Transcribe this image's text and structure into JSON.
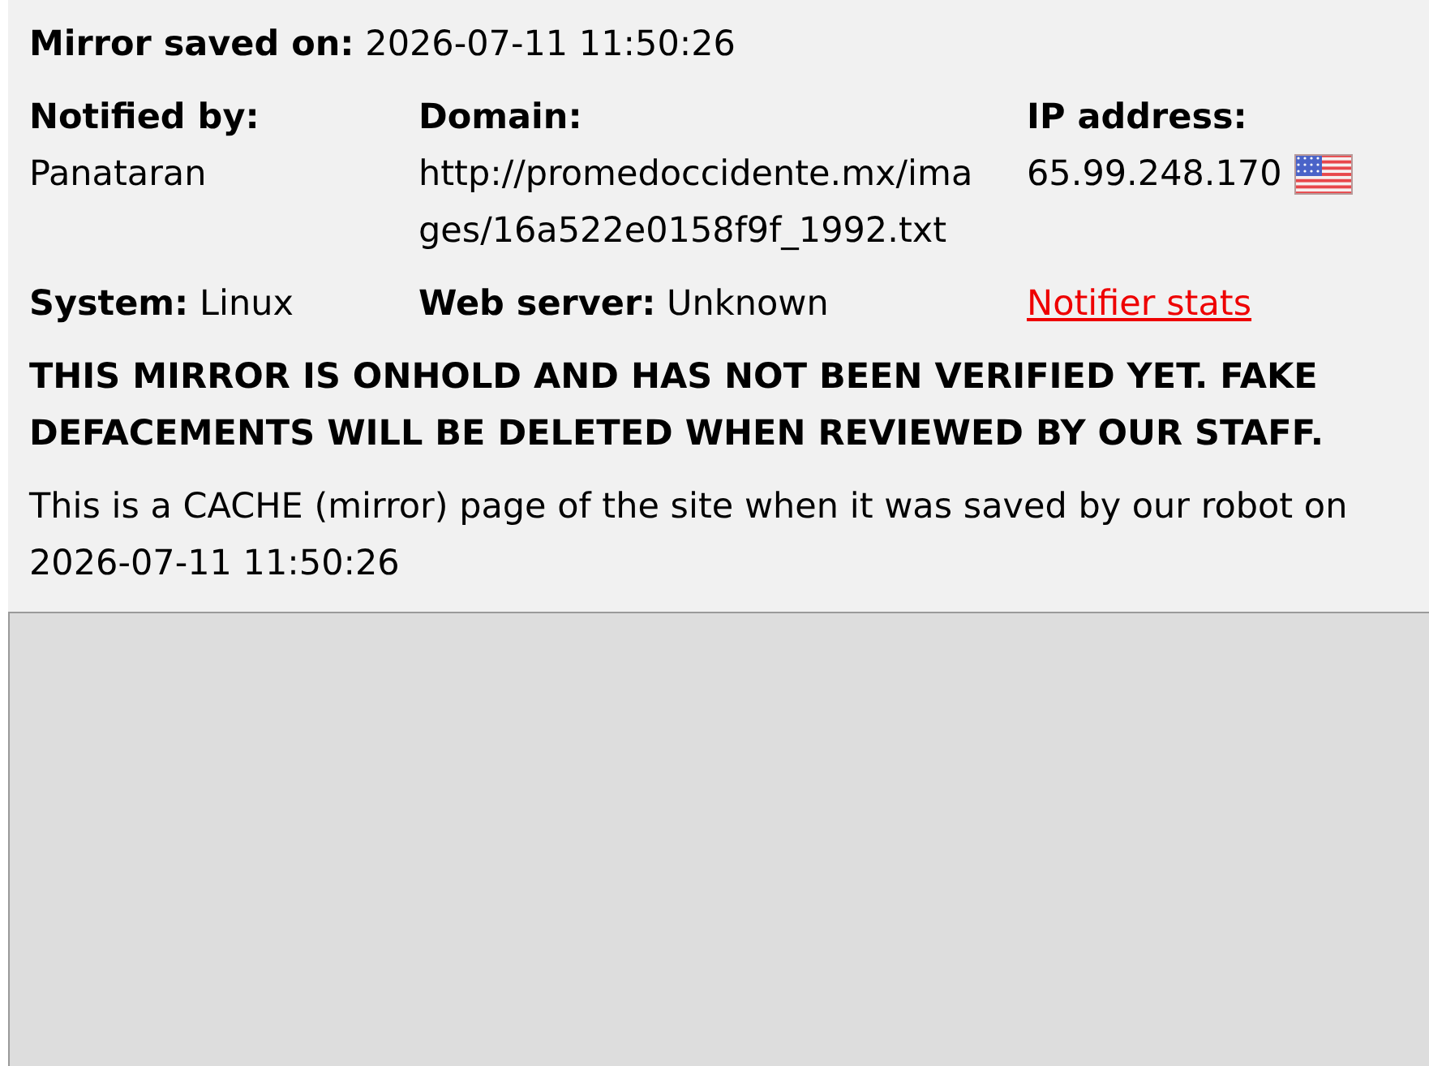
{
  "mirror_saved": {
    "label": "Mirror saved on:",
    "value": "2026-07-11 11:50:26"
  },
  "fields": [
    {
      "label": "Notified by:",
      "value": "Panataran"
    },
    {
      "label": "Domain:",
      "value": "http://promedoccidente.mx/images/16a522e0158f9f_1992.txt"
    },
    {
      "label": "IP address:",
      "value": "65.99.248.170"
    }
  ],
  "details": [
    {
      "label": "System:",
      "value": "Linux"
    },
    {
      "label": "Web server:",
      "value": "Unknown"
    }
  ],
  "notifier_stats_link": "Notifier stats",
  "warning": "THIS MIRROR IS ONHOLD AND HAS NOT BEEN VERIFIED YET. FAKE DEFACEMENTS WILL BE DELETED WHEN REVIEWED BY OUR STAFF.",
  "cache_notice": "This is a CACHE (mirror) page of the site when it was saved by our robot on 2026-07-11 11:50:26"
}
